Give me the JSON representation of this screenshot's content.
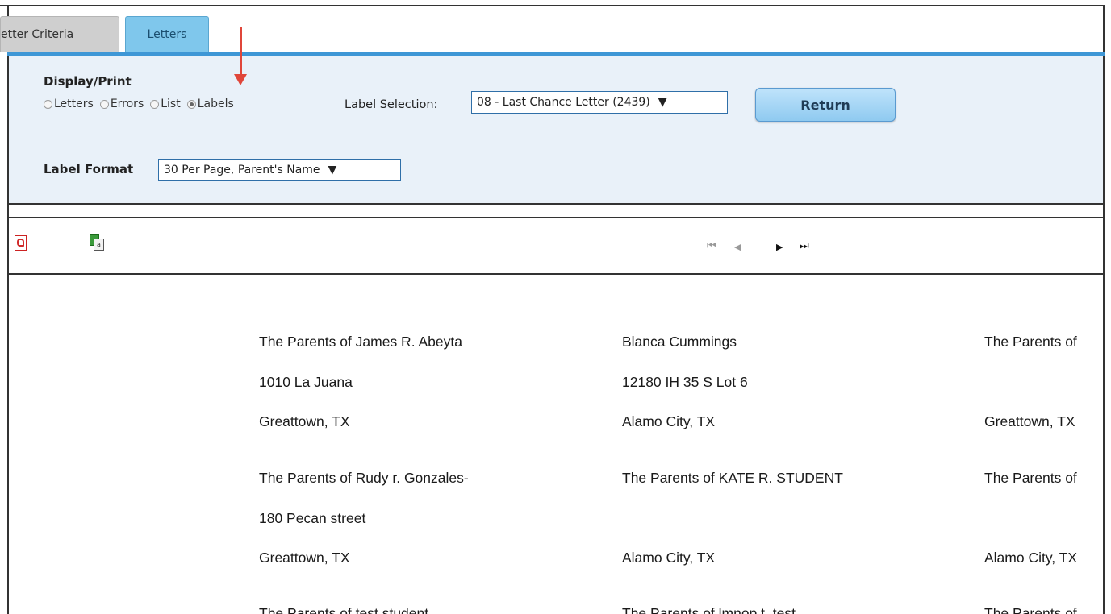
{
  "tabs": [
    {
      "label": "etter Criteria"
    },
    {
      "label": "Letters"
    }
  ],
  "display_print": {
    "title": "Display/Print",
    "options": [
      "Letters",
      "Errors",
      "List",
      "Labels"
    ],
    "selected": "Labels"
  },
  "label_selection": {
    "label": "Label Selection:",
    "value": "08 - Last Chance Letter (2439)"
  },
  "return_button": {
    "label": "Return"
  },
  "label_format": {
    "label": "Label Format",
    "value": "30 Per Page, Parent's Name"
  },
  "toolbar": {
    "icons": [
      "pdf-icon",
      "excel-export-icon"
    ],
    "pager": {
      "first": "⏮",
      "prev": "◀",
      "next": "▶",
      "last": "⏭"
    }
  },
  "labels": {
    "col1": [
      {
        "name": "The Parents of James R. Abeyta",
        "street": "1010 La Juana",
        "city": "Greattown, TX"
      },
      {
        "name": "The Parents of Rudy r. Gonzales-",
        "street": "180 Pecan street",
        "city": "Greattown, TX"
      },
      {
        "name": "The Parents of test student"
      }
    ],
    "col2": [
      {
        "name": "Blanca Cummings",
        "street": "12180 IH 35 S Lot 6",
        "city": "Alamo City, TX"
      },
      {
        "name": "The Parents of KATE R. STUDENT",
        "street": "",
        "city": "Alamo City, TX"
      },
      {
        "name": "The Parents of lmnop t. test"
      }
    ],
    "col3": [
      {
        "name": "The Parents of",
        "city": "Greattown, TX"
      },
      {
        "name": "The Parents of",
        "city": "Alamo City, TX"
      },
      {
        "name": "The Parents of"
      }
    ]
  },
  "colors": {
    "accent": "#3e97d6",
    "panel": "#e9f1f9",
    "arrow": "#e0463a"
  }
}
